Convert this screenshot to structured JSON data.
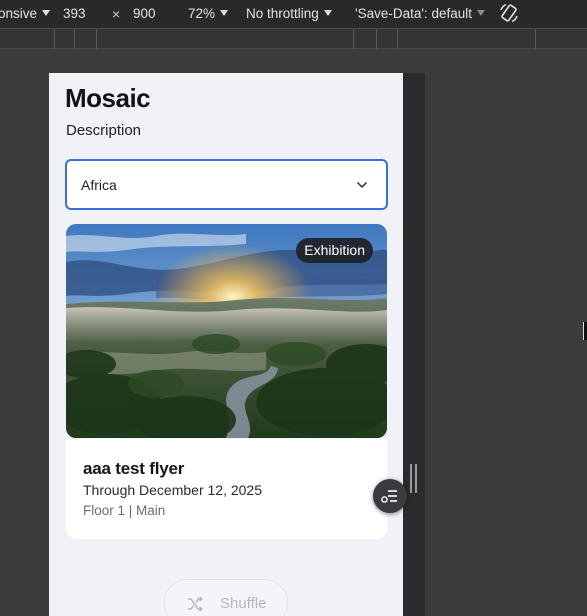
{
  "devtools": {
    "device_mode": "onsive",
    "width": "393",
    "times": "×",
    "height": "900",
    "zoom": "72%",
    "throttling": "No throttling",
    "save_data": "'Save-Data': default"
  },
  "page": {
    "title": "Mosaic",
    "description": "Description"
  },
  "region_select": {
    "value": "Africa"
  },
  "card": {
    "badge": "Exhibition",
    "title": "aaa test flyer",
    "dates": "Through December 12, 2025",
    "location": "Floor 1 | Main"
  },
  "shuffle": {
    "label": "Shuffle"
  },
  "colors": {
    "accent": "#3b6fd8",
    "viewport_bg": "#f1f2f8",
    "devtools_bg": "#292929"
  }
}
